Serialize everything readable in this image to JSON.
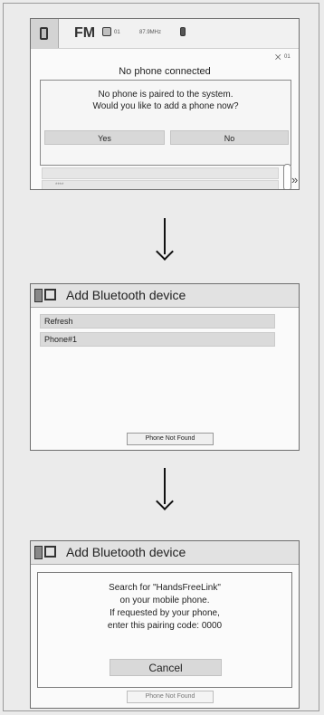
{
  "screen1": {
    "band": "FM",
    "station_tag": "01",
    "frequency": "87.9MHz",
    "corner_tag": "01",
    "status_text": "No phone connected",
    "dialog_line1": "No phone is paired to the system.",
    "dialog_line2": "Would you like to add a phone now?",
    "yes_label": "Yes",
    "no_label": "No",
    "dim_list_label": "****"
  },
  "screen2": {
    "title": "Add Bluetooth device",
    "items": [
      "Refresh",
      "Phone#1"
    ],
    "bottom_label": "Phone Not Found"
  },
  "screen3": {
    "title": "Add Bluetooth device",
    "line1": "Search for \"HandsFreeLink\"",
    "line2": "on your mobile phone.",
    "line3": "If requested by your phone,",
    "line4": "enter this pairing code: 0000",
    "cancel_label": "Cancel",
    "bottom_label": "Phone Not Found"
  },
  "colors": {
    "panel_bg": "#fafafa",
    "button": "#d8d8d8",
    "border": "#6e6e6e"
  }
}
